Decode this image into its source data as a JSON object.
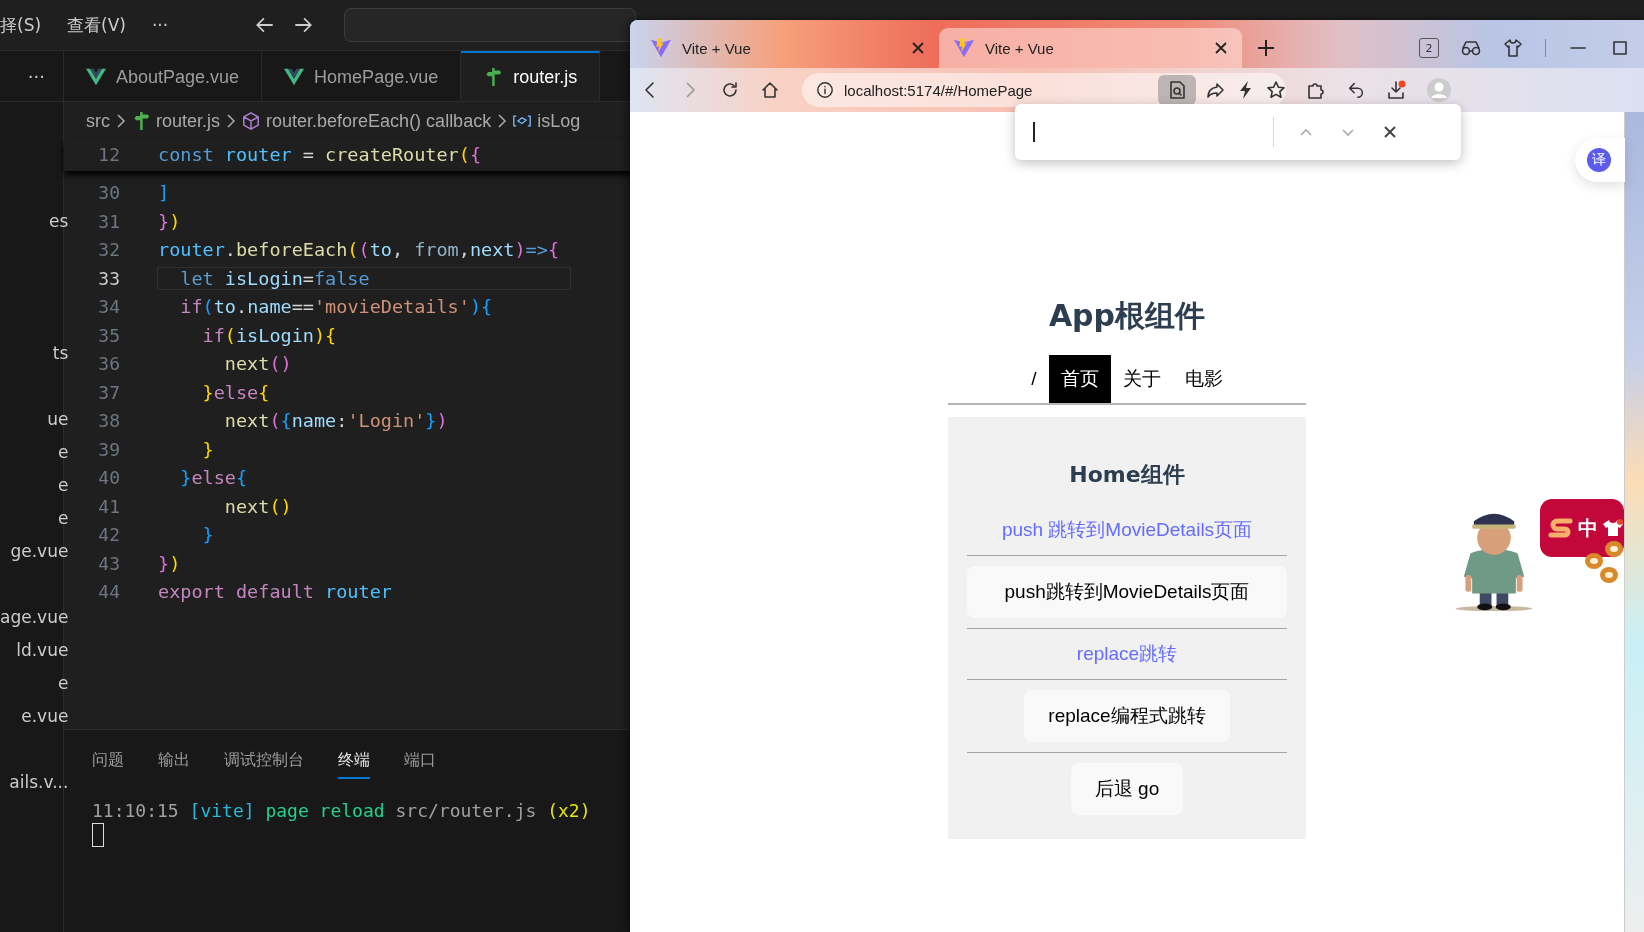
{
  "vscode": {
    "menu": [
      "择(S)",
      "查看(V)",
      "···"
    ],
    "explorer_more": "···",
    "explorer_items": [
      {
        "label": "es"
      },
      {
        "label": "ts"
      },
      {
        "label": "ue"
      },
      {
        "label": "e"
      },
      {
        "label": "e"
      },
      {
        "label": "e"
      },
      {
        "label": "ge.vue"
      },
      {
        "label": "age.vue"
      },
      {
        "label": "ld.vue"
      },
      {
        "label": "e"
      },
      {
        "label": "e.vue"
      },
      {
        "label": "ails.v..."
      }
    ],
    "tabs": [
      {
        "label": "AboutPage.vue",
        "kind": "vue",
        "selected": false
      },
      {
        "label": "HomePage.vue",
        "kind": "vue",
        "selected": false
      },
      {
        "label": "router.js",
        "kind": "router",
        "selected": true
      }
    ],
    "breadcrumb": [
      {
        "label": "src",
        "kind": "folder"
      },
      {
        "label": "router.js",
        "kind": "router"
      },
      {
        "label": "router.beforeEach() callback",
        "kind": "method"
      },
      {
        "label": "isLog",
        "kind": "variable"
      }
    ],
    "sticky_lines": [
      {
        "number": "12",
        "current": false,
        "tokens": [
          {
            "text": "const ",
            "kind": "kw"
          },
          {
            "text": "router",
            "kind": "var"
          },
          {
            "text": " = ",
            "kind": "plain"
          },
          {
            "text": "createRouter",
            "kind": "fn"
          },
          {
            "text": "(",
            "kind": "b1"
          },
          {
            "text": "{",
            "kind": "b2"
          }
        ]
      }
    ],
    "lines": [
      {
        "number": "30",
        "current": false,
        "tokens": [
          {
            "text": "]",
            "kind": "b3"
          }
        ]
      },
      {
        "number": "31",
        "current": false,
        "tokens": [
          {
            "text": "}",
            "kind": "b2"
          },
          {
            "text": ")",
            "kind": "b1"
          }
        ]
      },
      {
        "number": "32",
        "current": false,
        "tokens": [
          {
            "text": "router",
            "kind": "var"
          },
          {
            "text": ".",
            "kind": "plain"
          },
          {
            "text": "beforeEach",
            "kind": "fn"
          },
          {
            "text": "(",
            "kind": "b1"
          },
          {
            "text": "(",
            "kind": "b2"
          },
          {
            "text": "to",
            "kind": "param"
          },
          {
            "text": ", ",
            "kind": "plain"
          },
          {
            "text": "from",
            "kind": "dim"
          },
          {
            "text": ",",
            "kind": "plain"
          },
          {
            "text": "next",
            "kind": "param"
          },
          {
            "text": ")",
            "kind": "b2"
          },
          {
            "text": "=>",
            "kind": "kw"
          },
          {
            "text": "{",
            "kind": "b2"
          }
        ]
      },
      {
        "number": "33",
        "current": true,
        "tokens": [
          {
            "text": "  let ",
            "kind": "kw"
          },
          {
            "text": "isLogin",
            "kind": "param"
          },
          {
            "text": "=",
            "kind": "plain"
          },
          {
            "text": "false",
            "kind": "kw"
          }
        ]
      },
      {
        "number": "34",
        "current": false,
        "tokens": [
          {
            "text": "  if",
            "kind": "ctl"
          },
          {
            "text": "(",
            "kind": "b3"
          },
          {
            "text": "to",
            "kind": "param"
          },
          {
            "text": ".",
            "kind": "plain"
          },
          {
            "text": "name",
            "kind": "param"
          },
          {
            "text": "==",
            "kind": "plain"
          },
          {
            "text": "'movieDetails'",
            "kind": "str"
          },
          {
            "text": ")",
            "kind": "b3"
          },
          {
            "text": "{",
            "kind": "b3"
          }
        ]
      },
      {
        "number": "35",
        "current": false,
        "tokens": [
          {
            "text": "    if",
            "kind": "ctl"
          },
          {
            "text": "(",
            "kind": "b1"
          },
          {
            "text": "isLogin",
            "kind": "param"
          },
          {
            "text": ")",
            "kind": "b1"
          },
          {
            "text": "{",
            "kind": "b1"
          }
        ]
      },
      {
        "number": "36",
        "current": false,
        "tokens": [
          {
            "text": "      next",
            "kind": "fn"
          },
          {
            "text": "()",
            "kind": "b2"
          }
        ]
      },
      {
        "number": "37",
        "current": false,
        "tokens": [
          {
            "text": "    }",
            "kind": "b1"
          },
          {
            "text": "else",
            "kind": "ctl"
          },
          {
            "text": "{",
            "kind": "b1"
          }
        ]
      },
      {
        "number": "38",
        "current": false,
        "tokens": [
          {
            "text": "      next",
            "kind": "fn"
          },
          {
            "text": "(",
            "kind": "b2"
          },
          {
            "text": "{",
            "kind": "b3"
          },
          {
            "text": "name",
            "kind": "param"
          },
          {
            "text": ":",
            "kind": "plain"
          },
          {
            "text": "'Login'",
            "kind": "str"
          },
          {
            "text": "}",
            "kind": "b3"
          },
          {
            "text": ")",
            "kind": "b2"
          }
        ]
      },
      {
        "number": "39",
        "current": false,
        "tokens": [
          {
            "text": "    }",
            "kind": "b1"
          }
        ]
      },
      {
        "number": "40",
        "current": false,
        "tokens": [
          {
            "text": "  }",
            "kind": "b3"
          },
          {
            "text": "else",
            "kind": "ctl"
          },
          {
            "text": "{",
            "kind": "b3"
          }
        ]
      },
      {
        "number": "41",
        "current": false,
        "tokens": [
          {
            "text": "      next",
            "kind": "fn"
          },
          {
            "text": "()",
            "kind": "b1"
          }
        ]
      },
      {
        "number": "42",
        "current": false,
        "tokens": [
          {
            "text": "    }",
            "kind": "b3"
          }
        ]
      },
      {
        "number": "43",
        "current": false,
        "tokens": [
          {
            "text": "}",
            "kind": "b2"
          },
          {
            "text": ")",
            "kind": "b1"
          }
        ]
      },
      {
        "number": "44",
        "current": false,
        "tokens": [
          {
            "text": "export default ",
            "kind": "ctl"
          },
          {
            "text": "router",
            "kind": "var"
          }
        ]
      }
    ],
    "panel": {
      "tabs": [
        {
          "label": "问题",
          "selected": false
        },
        {
          "label": "输出",
          "selected": false
        },
        {
          "label": "调试控制台",
          "selected": false
        },
        {
          "label": "终端",
          "selected": true
        },
        {
          "label": "端口",
          "selected": false
        }
      ],
      "terminal": [
        {
          "text": "11:10:15 ",
          "kind": "time"
        },
        {
          "text": "[vite] ",
          "kind": "tag"
        },
        {
          "text": "page reload ",
          "kind": "msg"
        },
        {
          "text": "src/router.js ",
          "kind": "path"
        },
        {
          "text": "(x2)",
          "kind": "count"
        }
      ]
    }
  },
  "browser": {
    "tabs": [
      {
        "title": "Vite + Vue",
        "selected": false
      },
      {
        "title": "Vite + Vue",
        "selected": true
      }
    ],
    "tab_count": "2",
    "url": "localhost:5174/#/HomePage",
    "page": {
      "title": "App根组件",
      "nav": [
        {
          "label": "/",
          "selected": false
        },
        {
          "label": "首页",
          "selected": true
        },
        {
          "label": "关于",
          "selected": false
        },
        {
          "label": "电影",
          "selected": false
        }
      ],
      "home": {
        "title": "Home组件",
        "items": [
          {
            "kind": "link",
            "label": "push 跳转到MovieDetails页面"
          },
          {
            "kind": "button",
            "label": "push跳转到MovieDetails页面"
          },
          {
            "kind": "link",
            "label": "replace跳转"
          },
          {
            "kind": "button",
            "label": "replace编程式跳转"
          },
          {
            "kind": "button",
            "label": "后退 go"
          }
        ]
      }
    },
    "translate_button": {
      "label": "译"
    },
    "ime_badge": {
      "label": "中"
    }
  }
}
